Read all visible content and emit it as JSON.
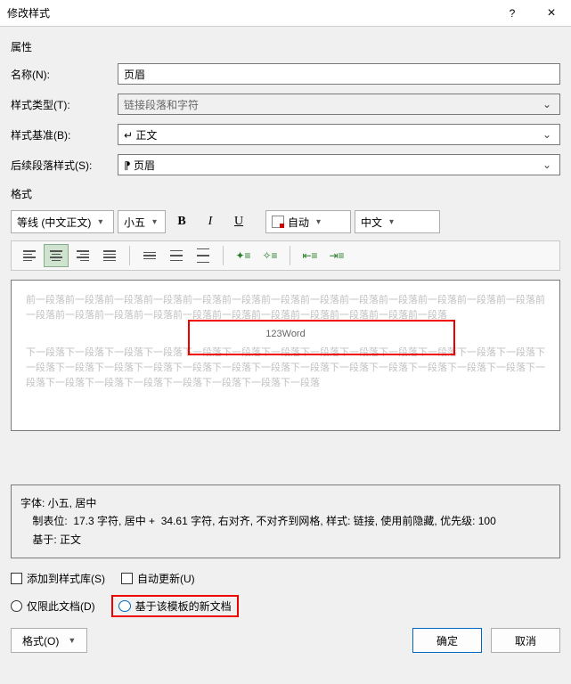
{
  "titlebar": {
    "title": "修改样式",
    "help": "?",
    "close": "×"
  },
  "section_props": "属性",
  "rows": {
    "name": {
      "label": "名称(N):",
      "value": "页眉"
    },
    "type": {
      "label": "样式类型(T):",
      "value": "链接段落和字符"
    },
    "base": {
      "label": "样式基准(B):",
      "value": "↵ 正文"
    },
    "follow": {
      "label": "后续段落样式(S):",
      "value": "⁋ 页眉"
    }
  },
  "section_format": "格式",
  "toolbar": {
    "font": "等线 (中文正文)",
    "size": "小五",
    "bold": "B",
    "italic": "I",
    "underline": "U",
    "color": "自动",
    "lang": "中文"
  },
  "preview": {
    "before": "前一段落前一段落前一段落前一段落前一段落前一段落前一段落前一段落前一段落前一段落前一段落前一段落前一段落前一段落前一段落前一段落前一段落前一段落前一段落前一段落前一段落前一段落前一段落前一段落",
    "sample": "123Word",
    "after": "下一段落下一段落下一段落下一段落下一段落下一段落下一段落下一段落下一段落下一段落下一段落下一段落下一段落下一段落下一段落下一段落下一段落下一段落下一段落下一段落下一段落下一段落下一段落下一段落下一段落下一段落下一段落下一段落下一段落下一段落下一段落下一段落下一段落下一段落"
  },
  "description": {
    "l1": "字体: 小五, 居中",
    "l2": "    制表位:  17.3 字符, 居中 +  34.61 字符, 右对齐, 不对齐到网格, 样式: 链接, 使用前隐藏, 优先级: 100",
    "l3": "    基于: 正文"
  },
  "checks": {
    "add_gallery": "添加到样式库(S)",
    "auto_update": "自动更新(U)",
    "this_doc": "仅限此文档(D)",
    "template": "基于该模板的新文档"
  },
  "footer": {
    "format": "格式(O)",
    "ok": "确定",
    "cancel": "取消"
  }
}
